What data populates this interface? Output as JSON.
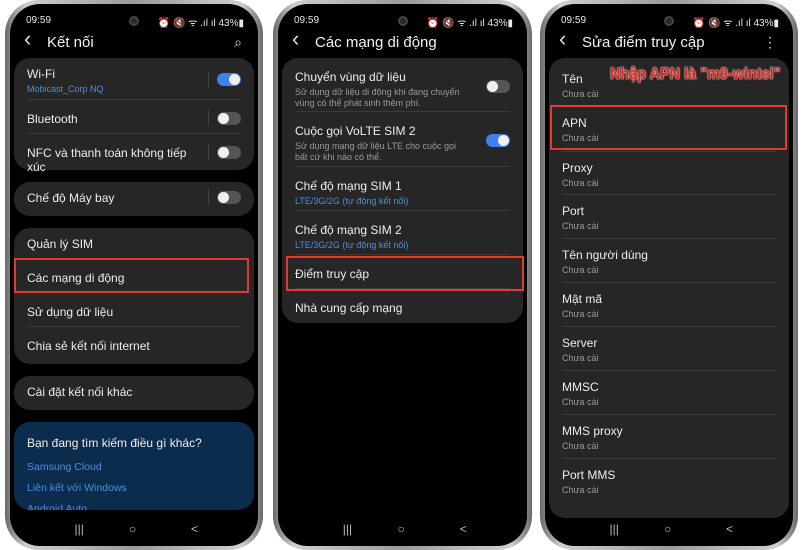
{
  "status": {
    "time": "09:59",
    "warn_icon": "warning-icon",
    "right": "⏰ 🔇 ᯤ .ıl ıl 43%▮",
    "battery": "43%"
  },
  "phones": [
    {
      "title": "Kết nối",
      "action_icon": "search-icon",
      "action": "⌕",
      "items": [
        {
          "label": "Wi-Fi",
          "sub": "Mobicast_Corp NQ",
          "sub_blue": true,
          "toggle": true
        },
        {
          "label": "Bluetooth",
          "toggle": false
        },
        {
          "label": "NFC và thanh toán không tiếp xúc",
          "toggle": false
        },
        {
          "label": "Chế độ Máy bay",
          "toggle": false
        },
        {
          "label": "Quản lý SIM"
        },
        {
          "label": "Các mạng di động",
          "highlighted": true
        },
        {
          "label": "Sử dụng dữ liệu"
        },
        {
          "label": "Chia sẻ kết nối internet"
        },
        {
          "label": "Cài đặt kết nối khác"
        }
      ],
      "suggest": {
        "question": "Bạn đang tìm kiếm điều gì khác?",
        "links": [
          "Samsung Cloud",
          "Liên kết với Windows",
          "Android Auto"
        ]
      }
    },
    {
      "title": "Các mạng di động",
      "items": [
        {
          "label": "Chuyển vùng dữ liệu",
          "sub": "Sử dụng dữ liệu di động khi đang chuyển vùng có thể phát sinh thêm phí.",
          "toggle": false
        },
        {
          "label": "Cuộc gọi VoLTE SIM 2",
          "sub": "Sử dụng mạng dữ liệu LTE cho cuộc gọi bất cứ khi nào có thể.",
          "toggle": true
        },
        {
          "label": "Chế độ mạng SIM 1",
          "sub": "LTE/3G/2G (tự động kết nối)",
          "sub_blue": true
        },
        {
          "label": "Chế độ mạng SIM 2",
          "sub": "LTE/3G/2G (tự động kết nối)",
          "sub_blue": true
        },
        {
          "label": "Điểm truy cập",
          "highlighted": true
        },
        {
          "label": "Nhà cung cấp mạng"
        }
      ]
    },
    {
      "title": "Sửa điểm truy cập",
      "action_icon": "more-options-icon",
      "action": "⋮",
      "annotation": "Nhập APN là \"m9-wintel\"",
      "items": [
        {
          "label": "Tên",
          "sub": "Chưa cài"
        },
        {
          "label": "APN",
          "sub": "Chưa cài",
          "highlighted": true
        },
        {
          "label": "Proxy",
          "sub": "Chưa cài"
        },
        {
          "label": "Port",
          "sub": "Chưa cài"
        },
        {
          "label": "Tên người dùng",
          "sub": "Chưa cài"
        },
        {
          "label": "Mật mã",
          "sub": "Chưa cài"
        },
        {
          "label": "Server",
          "sub": "Chưa cài"
        },
        {
          "label": "MMSC",
          "sub": "Chưa cài"
        },
        {
          "label": "MMS proxy",
          "sub": "Chưa cài"
        },
        {
          "label": "Port MMS",
          "sub": "Chưa cài"
        }
      ]
    }
  ],
  "nav": {
    "recents": "|||",
    "home": "○",
    "back": "<"
  },
  "colors": {
    "accent": "#3e82f0",
    "highlight": "#e5392b",
    "link": "#4a8fe0"
  }
}
